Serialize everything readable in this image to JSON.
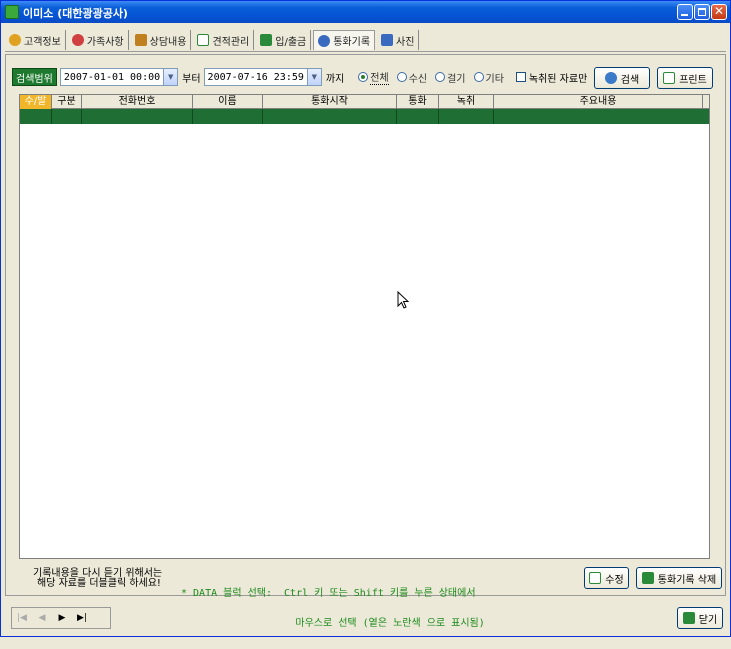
{
  "window": {
    "title": "이미소  (대한광광공사)"
  },
  "colors": {
    "titlebar": "#0a5fd8",
    "range_label": "#1e7a2e",
    "grid_row": "#1f6e33",
    "sort_header": "#f2b62a",
    "note": "#1c8a1c"
  },
  "tabs": [
    {
      "label": "고객정보",
      "icon": "person-icon",
      "color": "#e0a020"
    },
    {
      "label": "가족사항",
      "icon": "family-icon",
      "color": "#d04040"
    },
    {
      "label": "상담내용",
      "icon": "clipboard-icon",
      "color": "#c08020"
    },
    {
      "label": "견적관리",
      "icon": "document-icon",
      "color": "#2a8a3a"
    },
    {
      "label": "입/출금",
      "icon": "money-icon",
      "color": "#2a8a3a"
    },
    {
      "label": "통화기록",
      "icon": "phone-icon",
      "color": "#3a6ac0",
      "active": true
    },
    {
      "label": "사진",
      "icon": "photo-icon",
      "color": "#3a6ac0"
    }
  ],
  "filter": {
    "range_label": "검색범위",
    "from_value": "2007-01-01 00:00",
    "from_suffix": "부터",
    "to_value": "2007-07-16 23:59",
    "to_suffix": "까지",
    "radios": [
      {
        "label": "전체",
        "selected": true
      },
      {
        "label": "수신",
        "selected": false
      },
      {
        "label": "걸기",
        "selected": false
      },
      {
        "label": "기타",
        "selected": false
      }
    ],
    "recorded_only_label": "녹취된 자료만",
    "search_button": "검색",
    "print_button": "프린트"
  },
  "grid": {
    "columns": [
      "수/발",
      "구분",
      "전화번호",
      "이름",
      "통화시작",
      "통화",
      "녹취",
      "주요내용"
    ],
    "rows": [
      [
        "",
        "",
        "",
        "",
        "",
        "",
        "",
        ""
      ]
    ]
  },
  "footer": {
    "note_left_1": "기록내용을 다시 듣기 위해서는",
    "note_left_2": "해당 자료를 더블클릭 하세요!",
    "note_right_1": "* DATA 블럭 선택:  Ctrl 키 또는 Shift 키를 누른 상태에서",
    "note_right_2": "                   마우스로 선택 (옅은 노란색 으로 표시됨)",
    "edit_button": "수정",
    "delete_button": "통화기록 삭제",
    "close_button": "닫기"
  }
}
